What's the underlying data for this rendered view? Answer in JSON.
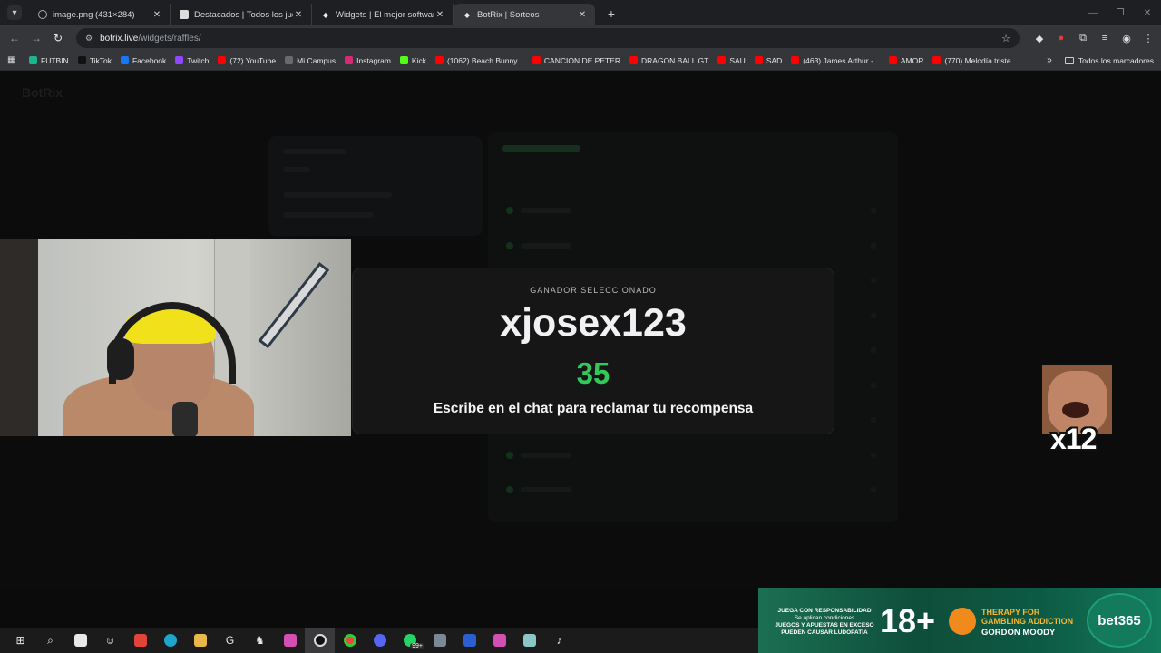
{
  "browser": {
    "tabs": [
      {
        "title": "image.png (431×284)",
        "active": false
      },
      {
        "title": "Destacados | Todos los juegos |",
        "active": false
      },
      {
        "title": "Widgets | El mejor software pa",
        "active": false
      },
      {
        "title": "BotRix | Sorteos",
        "active": true
      }
    ],
    "url_host": "botrix.live",
    "url_path": "/widgets/raffles/",
    "bookmarks": [
      {
        "label": "FUTBIN",
        "color": "#1cb48a"
      },
      {
        "label": "TikTok",
        "color": "#111111"
      },
      {
        "label": "Facebook",
        "color": "#1877f2"
      },
      {
        "label": "Twitch",
        "color": "#9146ff"
      },
      {
        "label": "(72) YouTube",
        "color": "#ff0000"
      },
      {
        "label": "Mi Campus",
        "color": "#6a6a6a"
      },
      {
        "label": "Instagram",
        "color": "#d62976"
      },
      {
        "label": "Kick",
        "color": "#53fc18"
      },
      {
        "label": "(1062) Beach Bunny...",
        "color": "#ff0000"
      },
      {
        "label": "CANCION DE PETER",
        "color": "#ff0000"
      },
      {
        "label": "DRAGON BALL GT",
        "color": "#ff0000"
      },
      {
        "label": "SAU",
        "color": "#ff0000"
      },
      {
        "label": "SAD",
        "color": "#ff0000"
      },
      {
        "label": "(463) James Arthur -...",
        "color": "#ff0000"
      },
      {
        "label": "AMOR",
        "color": "#ff0000"
      },
      {
        "label": "(770) Melodía triste...",
        "color": "#ff0000"
      }
    ],
    "bookmarks_more": "»",
    "all_bookmarks": "Todos los marcadores"
  },
  "winner_card": {
    "label": "GANADOR SELECCIONADO",
    "name": "xjosex123",
    "count": "35",
    "message": "Escribe en el chat para reclamar tu recompensa",
    "count_color": "#35c75a"
  },
  "emote": {
    "multiplier": "x12"
  },
  "taskbar": {
    "badge": "99+"
  },
  "ad": {
    "responsible_title": "JUEGA CON RESPONSABILIDAD",
    "responsible_sub": "Se aplican condiciones",
    "responsible_warning": "JUEGOS Y APUESTAS EN EXCESO PUEDEN CAUSAR LUDOPATÍA",
    "age": "18+",
    "therapy": "THERAPY FOR GAMBLING ADDICTION",
    "gordon": "GORDON MOODY",
    "brand": "bet365"
  }
}
